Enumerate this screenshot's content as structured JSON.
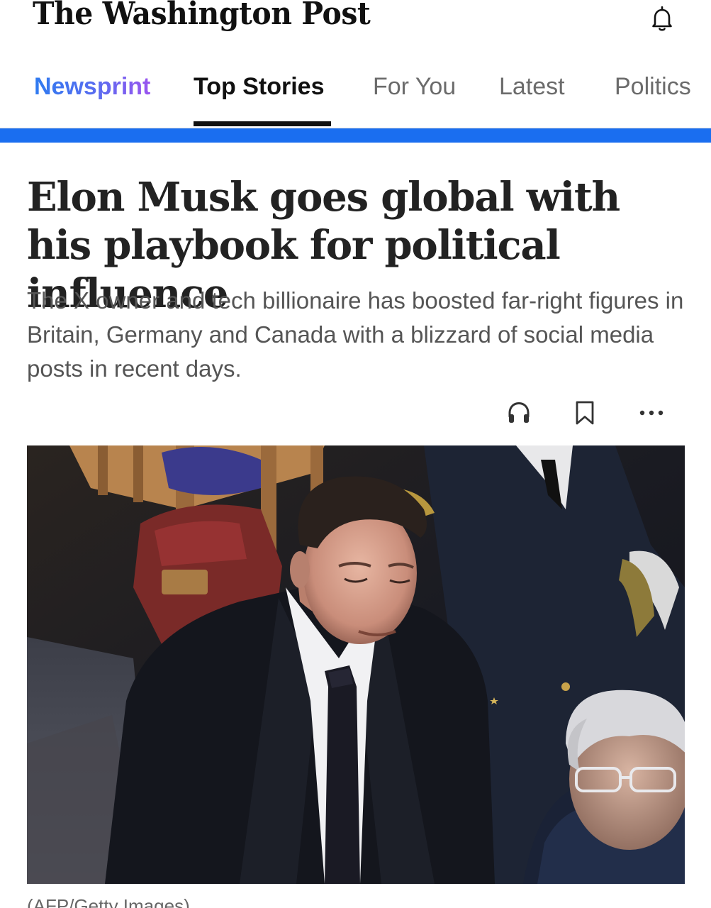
{
  "header": {
    "logo": "The Washington Post",
    "notifications_icon": "bell-icon"
  },
  "nav": {
    "tabs": [
      {
        "label": "Newsprint",
        "style": "gradient"
      },
      {
        "label": "Top Stories",
        "active": true
      },
      {
        "label": "For You"
      },
      {
        "label": "Latest"
      },
      {
        "label": "Politics"
      }
    ],
    "accent_color": "#1a6ef0"
  },
  "article": {
    "headline": "Elon Musk goes global with his playbook for political influence",
    "dek": "The X owner and tech billionaire has boosted far-right figures in Britain, Germany and Canada with a blizzard of social media posts in recent days.",
    "actions": [
      {
        "icon": "headphones-icon"
      },
      {
        "icon": "bookmark-icon"
      },
      {
        "icon": "more-icon"
      }
    ],
    "photo_caption": "(AFP/Getty Images)"
  }
}
